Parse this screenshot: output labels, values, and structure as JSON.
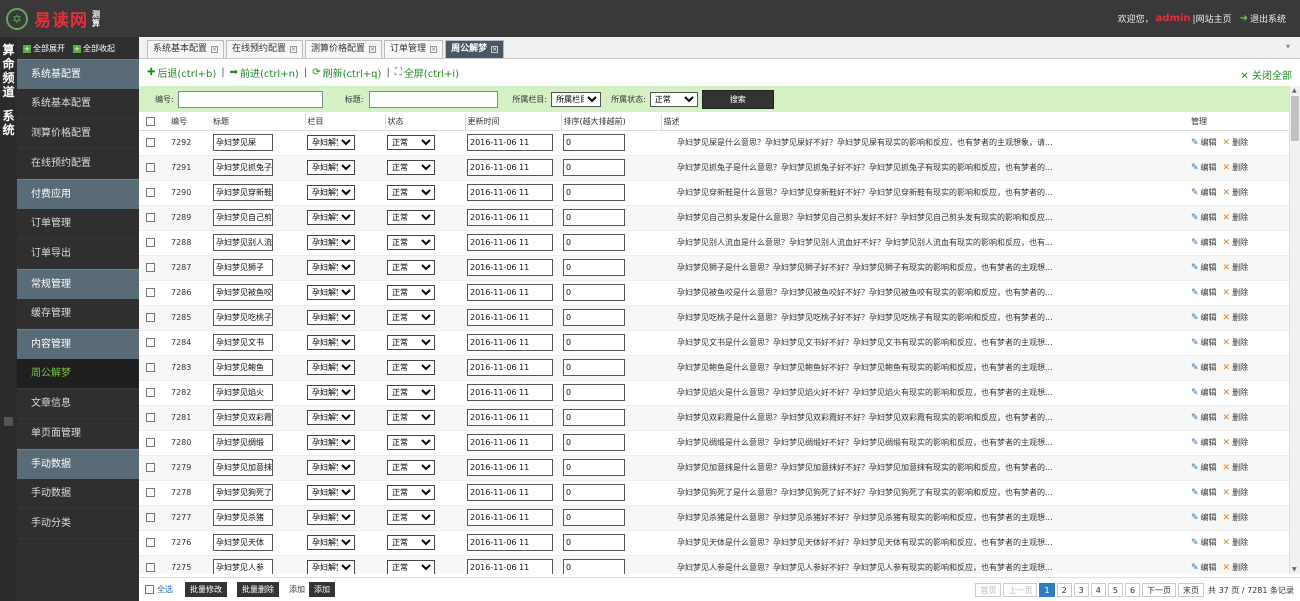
{
  "header": {
    "logo_emblem": "✡",
    "site_name": "易读网",
    "site_sub": "测算",
    "welcome": "欢迎您，",
    "user": "admin",
    "home_link": "|网站主页",
    "logout": "退出系统"
  },
  "rail": {
    "chars": [
      "算",
      "命",
      "频",
      "道",
      "系",
      "统"
    ]
  },
  "sidebar": {
    "expand_all": "全部展开",
    "collapse_all": "全部收起",
    "items": [
      {
        "type": "group",
        "label": "系统基配置"
      },
      {
        "type": "item",
        "label": "系统基本配置"
      },
      {
        "type": "item",
        "label": "测算价格配置"
      },
      {
        "type": "item",
        "label": "在线预约配置"
      },
      {
        "type": "group",
        "label": "付费应用"
      },
      {
        "type": "item",
        "label": "订单管理"
      },
      {
        "type": "item",
        "label": "订单导出"
      },
      {
        "type": "group",
        "label": "常规管理"
      },
      {
        "type": "item",
        "label": "缓存管理"
      },
      {
        "type": "group",
        "label": "内容管理"
      },
      {
        "type": "item",
        "label": "周公解梦",
        "active": true
      },
      {
        "type": "item",
        "label": "文章信息"
      },
      {
        "type": "item",
        "label": "单页面管理"
      },
      {
        "type": "group",
        "label": "手动数据"
      },
      {
        "type": "item",
        "label": "手动数据"
      },
      {
        "type": "item",
        "label": "手动分类"
      }
    ]
  },
  "tabs": [
    {
      "label": "系统基本配置",
      "active": false
    },
    {
      "label": "在线预约配置",
      "active": false
    },
    {
      "label": "测算价格配置",
      "active": false
    },
    {
      "label": "订单管理",
      "active": false
    },
    {
      "label": "周公解梦",
      "active": true
    }
  ],
  "toolbar": {
    "back": "后退(ctrl+b)",
    "forward": "前进(ctrl+n)",
    "refresh": "刷新(ctrl+q)",
    "fullscreen": "全屏(ctrl+i)",
    "close_all": "关闭全部"
  },
  "filter": {
    "id_label": "编号:",
    "title_label": "标题:",
    "column_label": "所属栏目:",
    "column_value": "所属栏目",
    "status_label": "所属状态:",
    "status_value": "正常",
    "search": "搜索"
  },
  "table": {
    "headers": {
      "id": "编号",
      "title": "标题",
      "column": "栏目",
      "status": "状态",
      "time": "更新时间",
      "sort": "排序(越大排越前)",
      "desc": "描述",
      "manage": "管理"
    },
    "edit_label": "编辑",
    "delete_label": "删除",
    "rows": [
      {
        "id": "7292",
        "title": "孕妇梦见屎",
        "column": "孕妇解梦",
        "status": "正常",
        "time": "2016-11-06 11",
        "sort": "0",
        "desc": "孕妇梦见屎是什么意思？孕妇梦见屎好不好？孕妇梦见屎有现实的影响和反应，也有梦者的主观想象，请..."
      },
      {
        "id": "7291",
        "title": "孕妇梦见抓兔子",
        "column": "孕妇解梦",
        "status": "正常",
        "time": "2016-11-06 11",
        "sort": "0",
        "desc": "孕妇梦见抓兔子是什么意思？孕妇梦见抓兔子好不好？孕妇梦见抓兔子有现实的影响和反应，也有梦者的..."
      },
      {
        "id": "7290",
        "title": "孕妇梦见穿新鞋",
        "column": "孕妇解梦",
        "status": "正常",
        "time": "2016-11-06 11",
        "sort": "0",
        "desc": "孕妇梦见穿新鞋是什么意思？孕妇梦见穿新鞋好不好？孕妇梦见穿新鞋有现实的影响和反应，也有梦者的..."
      },
      {
        "id": "7289",
        "title": "孕妇梦见自己剪头发",
        "column": "孕妇解梦",
        "status": "正常",
        "time": "2016-11-06 11",
        "sort": "0",
        "desc": "孕妇梦见自己剪头发是什么意思？孕妇梦见自己剪头发好不好？孕妇梦见自己剪头发有现实的影响和反应..."
      },
      {
        "id": "7288",
        "title": "孕妇梦见别人流血",
        "column": "孕妇解梦",
        "status": "正常",
        "time": "2016-11-06 11",
        "sort": "0",
        "desc": "孕妇梦见别人流血是什么意思？孕妇梦见别人流血好不好？孕妇梦见别人流血有现实的影响和反应，也有..."
      },
      {
        "id": "7287",
        "title": "孕妇梦见狮子",
        "column": "孕妇解梦",
        "status": "正常",
        "time": "2016-11-06 11",
        "sort": "0",
        "desc": "孕妇梦见狮子是什么意思？孕妇梦见狮子好不好？孕妇梦见狮子有现实的影响和反应，也有梦者的主观想..."
      },
      {
        "id": "7286",
        "title": "孕妇梦见被鱼咬",
        "column": "孕妇解梦",
        "status": "正常",
        "time": "2016-11-06 11",
        "sort": "0",
        "desc": "孕妇梦见被鱼咬是什么意思？孕妇梦见被鱼咬好不好？孕妇梦见被鱼咬有现实的影响和反应，也有梦者的..."
      },
      {
        "id": "7285",
        "title": "孕妇梦见吃桃子",
        "column": "孕妇解梦",
        "status": "正常",
        "time": "2016-11-06 11",
        "sort": "0",
        "desc": "孕妇梦见吃桃子是什么意思？孕妇梦见吃桃子好不好？孕妇梦见吃桃子有现实的影响和反应，也有梦者的..."
      },
      {
        "id": "7284",
        "title": "孕妇梦见文书",
        "column": "孕妇解梦",
        "status": "正常",
        "time": "2016-11-06 11",
        "sort": "0",
        "desc": "孕妇梦见文书是什么意思？孕妇梦见文书好不好？孕妇梦见文书有现实的影响和反应，也有梦者的主观想..."
      },
      {
        "id": "7283",
        "title": "孕妇梦见鲍鱼",
        "column": "孕妇解梦",
        "status": "正常",
        "time": "2016-11-06 11",
        "sort": "0",
        "desc": "孕妇梦见鲍鱼是什么意思？孕妇梦见鲍鱼好不好？孕妇梦见鲍鱼有现实的影响和反应，也有梦者的主观想..."
      },
      {
        "id": "7282",
        "title": "孕妇梦见焰火",
        "column": "孕妇解梦",
        "status": "正常",
        "time": "2016-11-06 11",
        "sort": "0",
        "desc": "孕妇梦见焰火是什么意思？孕妇梦见焰火好不好？孕妇梦见焰火有现实的影响和反应，也有梦者的主观想..."
      },
      {
        "id": "7281",
        "title": "孕妇梦见双彩霞",
        "column": "孕妇解梦",
        "status": "正常",
        "time": "2016-11-06 11",
        "sort": "0",
        "desc": "孕妇梦见双彩霞是什么意思？孕妇梦见双彩霞好不好？孕妇梦见双彩霞有现实的影响和反应，也有梦者的..."
      },
      {
        "id": "7280",
        "title": "孕妇梦见绸缎",
        "column": "孕妇解梦",
        "status": "正常",
        "time": "2016-11-06 11",
        "sort": "0",
        "desc": "孕妇梦见绸缎是什么意思？孕妇梦见绸缎好不好？孕妇梦见绸缎有现实的影响和反应，也有梦者的主观想..."
      },
      {
        "id": "7279",
        "title": "孕妇梦见加意抹",
        "column": "孕妇解梦",
        "status": "正常",
        "time": "2016-11-06 11",
        "sort": "0",
        "desc": "孕妇梦见加意抹是什么意思？孕妇梦见加意抹好不好？孕妇梦见加意抹有现实的影响和反应，也有梦者的..."
      },
      {
        "id": "7278",
        "title": "孕妇梦见狗死了",
        "column": "孕妇解梦",
        "status": "正常",
        "time": "2016-11-06 11",
        "sort": "0",
        "desc": "孕妇梦见狗死了是什么意思？孕妇梦见狗死了好不好？孕妇梦见狗死了有现实的影响和反应，也有梦者的..."
      },
      {
        "id": "7277",
        "title": "孕妇梦见杀猪",
        "column": "孕妇解梦",
        "status": "正常",
        "time": "2016-11-06 11",
        "sort": "0",
        "desc": "孕妇梦见杀猪是什么意思？孕妇梦见杀猪好不好？孕妇梦见杀猪有现实的影响和反应，也有梦者的主观想..."
      },
      {
        "id": "7276",
        "title": "孕妇梦见天体",
        "column": "孕妇解梦",
        "status": "正常",
        "time": "2016-11-06 11",
        "sort": "0",
        "desc": "孕妇梦见天体是什么意思？孕妇梦见天体好不好？孕妇梦见天体有现实的影响和反应，也有梦者的主观想..."
      },
      {
        "id": "7275",
        "title": "孕妇梦见人参",
        "column": "孕妇解梦",
        "status": "正常",
        "time": "2016-11-06 11",
        "sort": "0",
        "desc": "孕妇梦见人参是什么意思？孕妇梦见人参好不好？孕妇梦见人参有现实的影响和反应，也有梦者的主观想..."
      }
    ]
  },
  "bottom": {
    "select_all": "全选",
    "batch_edit": "批量修改",
    "batch_delete": "批量删除",
    "add_text": "添加",
    "add_button": "添加"
  },
  "pager": {
    "first": "首页",
    "prev": "上一页",
    "pages": [
      "1",
      "2",
      "3",
      "4",
      "5",
      "6"
    ],
    "current": "1",
    "next": "下一页",
    "last": "末页",
    "summary": "共 37 页 / 7281 条记录"
  }
}
